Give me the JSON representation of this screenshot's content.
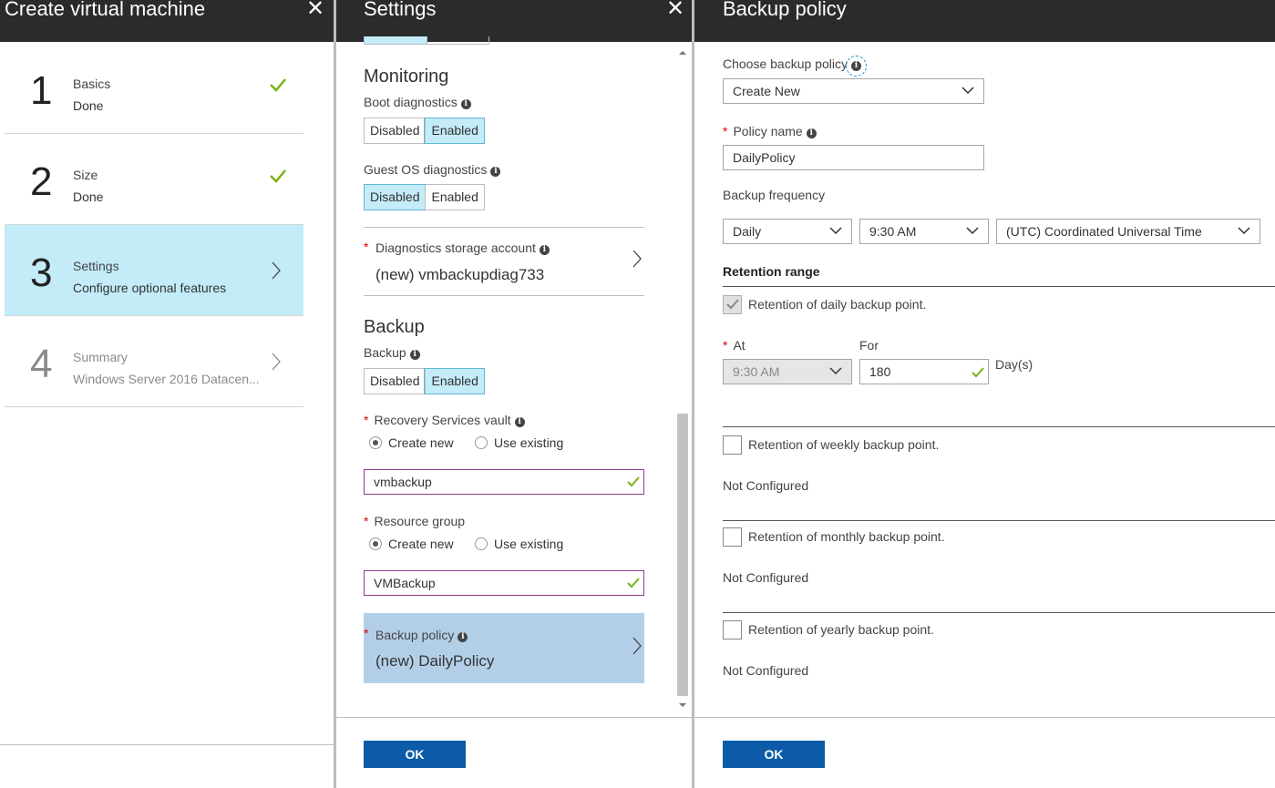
{
  "blade1": {
    "title": "Create virtual machine",
    "steps": [
      {
        "num": "1",
        "name": "Basics",
        "status": "Done"
      },
      {
        "num": "2",
        "name": "Size",
        "status": "Done"
      },
      {
        "num": "3",
        "name": "Settings",
        "status": "Configure optional features"
      },
      {
        "num": "4",
        "name": "Summary",
        "status": "Windows Server 2016 Datacen..."
      }
    ]
  },
  "blade2": {
    "title": "Settings",
    "monitoring_title": "Monitoring",
    "boot_diag_label": "Boot diagnostics",
    "guest_diag_label": "Guest OS diagnostics",
    "toggle_disabled": "Disabled",
    "toggle_enabled": "Enabled",
    "diag_storage_label": "Diagnostics storage account",
    "diag_storage_value": "(new) vmbackupdiag733",
    "backup_title": "Backup",
    "backup_label": "Backup",
    "vault_label": "Recovery Services vault",
    "create_new": "Create new",
    "use_existing": "Use existing",
    "vault_value": "vmbackup",
    "rg_label": "Resource group",
    "rg_value": "VMBackup",
    "policy_label": "Backup policy",
    "policy_value": "(new) DailyPolicy",
    "ok": "OK"
  },
  "blade3": {
    "title": "Backup policy",
    "choose_label": "Choose backup policy",
    "choose_value": "Create New",
    "policy_name_label": "Policy name",
    "policy_name_value": "DailyPolicy",
    "frequency_label": "Backup frequency",
    "frequency_value": "Daily",
    "time_value": "9:30 AM",
    "timezone_value": "(UTC) Coordinated Universal Time",
    "retention_title": "Retention range",
    "daily_label": "Retention of daily backup point.",
    "at_label": "At",
    "for_label": "For",
    "at_value": "9:30 AM",
    "for_value": "180",
    "days_label": "Day(s)",
    "weekly_label": "Retention of weekly backup point.",
    "monthly_label": "Retention of monthly backup point.",
    "yearly_label": "Retention of yearly backup point.",
    "not_configured": "Not Configured",
    "ok": "OK"
  },
  "colors": {
    "header": "#2b2b2b",
    "selected": "#c3ebf8",
    "ok_button": "#0b5ba8",
    "valid_check": "#7ab317",
    "required": "#e00000"
  },
  "icons": [
    "close-icon",
    "checkmark-icon",
    "chevron-right-icon",
    "info-icon",
    "chevron-down-icon"
  ]
}
